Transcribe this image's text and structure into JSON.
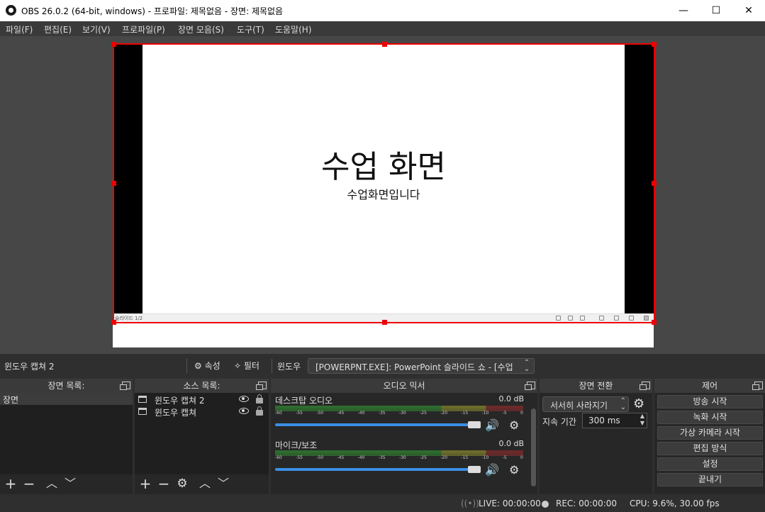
{
  "window": {
    "title": "OBS 26.0.2 (64-bit, windows) - 프로파일: 제목없음 - 장면: 제목없음",
    "minimize": "—",
    "maximize": "☐",
    "close": "✕"
  },
  "menu": [
    "파일(F)",
    "편집(E)",
    "보기(V)",
    "프로파일(P)",
    "장면 모음(S)",
    "도구(T)",
    "도움말(H)"
  ],
  "slide": {
    "title": "수업 화면",
    "subtitle": "수업화면입니다",
    "counter": "슬라이드 1/2"
  },
  "source_toolbar": {
    "name": "윈도우 캡쳐 2",
    "properties": "속성",
    "filters": "필터",
    "window_label": "윈도우",
    "window_value": "[POWERPNT.EXE]: PowerPoint 슬라이드 쇼 - [수업"
  },
  "docks": {
    "scenes": {
      "title": "장면 목록:",
      "items": [
        "장면"
      ]
    },
    "sources": {
      "title": "소스 목록:",
      "items": [
        "윈도우 캡쳐 2",
        "윈도우 캡쳐"
      ]
    },
    "mixer": {
      "title": "오디오 믹서",
      "channels": [
        {
          "name": "데스크탑 오디오",
          "db": "0.0 dB"
        },
        {
          "name": "마이크/보조",
          "db": "0.0 dB"
        }
      ],
      "scale": [
        "-60",
        "-55",
        "-50",
        "-45",
        "-40",
        "-35",
        "-30",
        "-25",
        "-20",
        "-15",
        "-10",
        "-5",
        "0"
      ]
    },
    "transitions": {
      "title": "장면 전환",
      "selected": "서서히 사라지기",
      "duration_label": "지속 기간",
      "duration": "300 ms"
    },
    "controls": {
      "title": "제어",
      "buttons": [
        "방송 시작",
        "녹화 시작",
        "가상 카메라 시작",
        "편집 방식",
        "설정",
        "끝내기"
      ]
    }
  },
  "status": {
    "live": "LIVE: 00:00:00",
    "rec": "REC: 00:00:00",
    "cpu": "CPU: 9.6%, 30.00 fps"
  },
  "colors": {
    "selection": "#ee0000",
    "volume": "#3b8ee6",
    "background": "#2f2f2f"
  }
}
